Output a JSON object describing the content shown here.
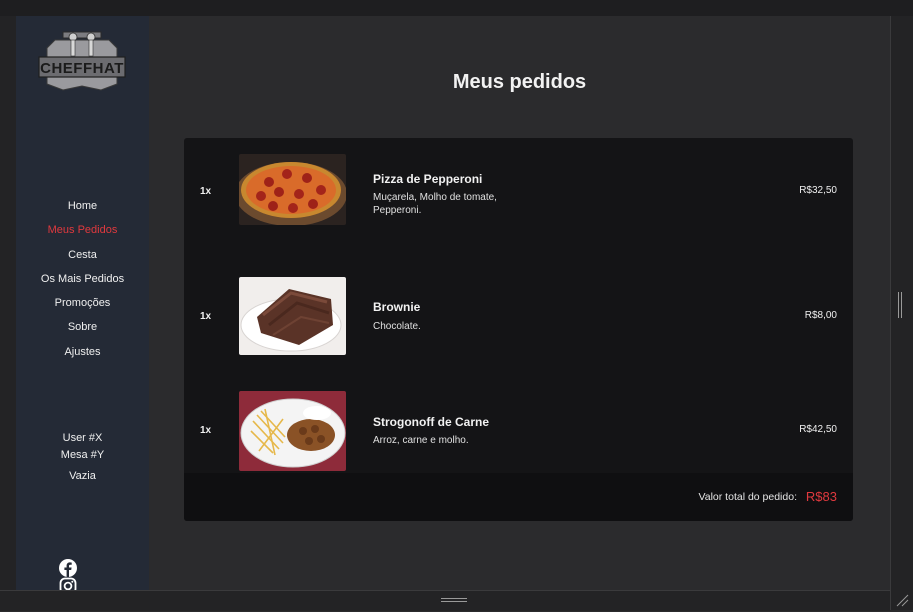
{
  "app": {
    "brand": "CHEFFHAT",
    "page_title": "Meus pedidos"
  },
  "sidebar": {
    "items": [
      {
        "label": "Home",
        "active": false
      },
      {
        "label": "Meus Pedidos",
        "active": true
      },
      {
        "label": "Cesta",
        "active": false
      },
      {
        "label": "Os Mais Pedidos",
        "active": false
      },
      {
        "label": "Promoções",
        "active": false
      },
      {
        "label": "Sobre",
        "active": false
      },
      {
        "label": "Ajustes",
        "active": false
      }
    ],
    "user": "User #X",
    "table": "Mesa #Y",
    "status": "Vazia",
    "social": [
      "facebook-icon",
      "instagram-icon"
    ]
  },
  "orders": {
    "items": [
      {
        "qty": "1x",
        "name": "Pizza de Pepperoni",
        "description": "Muçarela, Molho de tomate, Pepperoni.",
        "price": "R$32,50",
        "image": "pepperoni-pizza"
      },
      {
        "qty": "1x",
        "name": "Brownie",
        "description": "Chocolate.",
        "price": "R$8,00",
        "image": "brownie"
      },
      {
        "qty": "1x",
        "name": "Strogonoff de Carne",
        "description": "Arroz, carne e molho.",
        "price": "R$42,50",
        "image": "beef-stroganoff"
      }
    ],
    "total_label": "Valor total do pedido:",
    "total_value": "R$83"
  },
  "colors": {
    "accent": "#e0393e",
    "sidebar_bg": "#242a36",
    "card_bg": "#141416",
    "page_bg": "#2b2b2d"
  }
}
